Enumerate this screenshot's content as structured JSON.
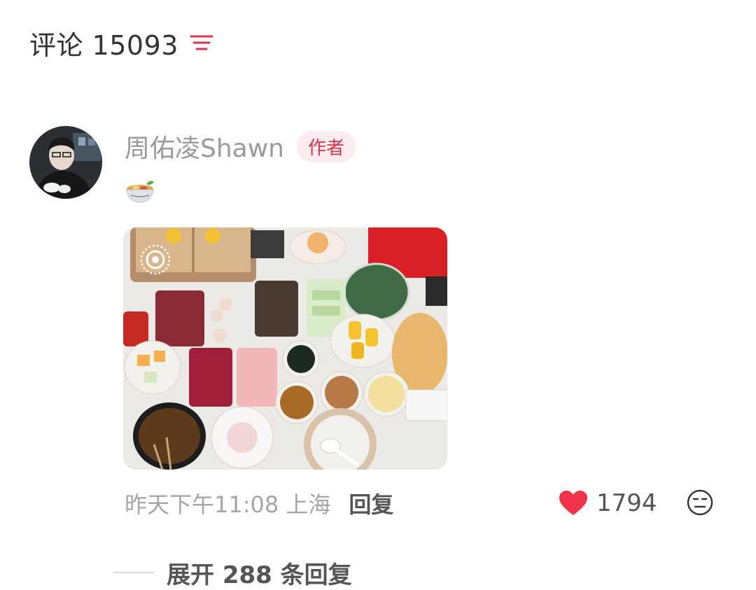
{
  "comments_header": {
    "title": "评论 15093"
  },
  "comment": {
    "author": "周佑凌Shawn",
    "author_badge": "作者",
    "time_location": "昨天下午11:08 上海",
    "reply_label": "回复",
    "likes": "1794"
  },
  "expand_replies": {
    "label": "展开 288 条回复"
  },
  "colors": {
    "accent": "#e0314a",
    "badge_bg": "#fdecee",
    "muted_text": "#9a9a9a",
    "like_heart": "#f1334a"
  },
  "icons": [
    "filter-icon",
    "noodle-bowl-emoji-icon",
    "live-photo-icon",
    "heart-icon",
    "dislike-face-icon"
  ]
}
